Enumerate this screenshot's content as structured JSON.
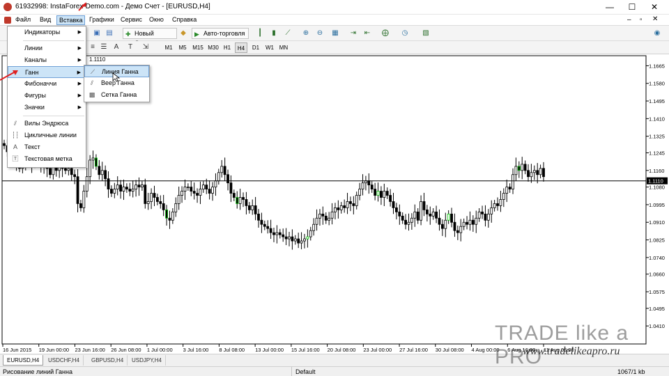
{
  "window": {
    "title": "61932998: InstaForex-Demo.com - Демо Счет - [EURUSD,H4]",
    "controls": [
      "—",
      "☐",
      "✕"
    ]
  },
  "menubar": {
    "items": [
      "Файл",
      "Вид",
      "Вставка",
      "Графики",
      "Сервис",
      "Окно",
      "Справка"
    ],
    "active_index": 2
  },
  "toolbar1": {
    "new_order_label": "Новый Ордер",
    "autotrade_label": "Авто-торговля"
  },
  "toolbar2": {
    "timeframes": [
      "M1",
      "M5",
      "M15",
      "M30",
      "H1",
      "H4",
      "D1",
      "W1",
      "MN"
    ],
    "selected_timeframe": "H4"
  },
  "insert_menu": {
    "items": [
      {
        "label": "Индикаторы",
        "submenu": true,
        "icon": ""
      },
      {
        "label": "Линии",
        "submenu": true,
        "icon": ""
      },
      {
        "label": "Каналы",
        "submenu": true,
        "icon": ""
      },
      {
        "label": "Ганн",
        "submenu": true,
        "icon": "",
        "active": true
      },
      {
        "label": "Фибоначчи",
        "submenu": true,
        "icon": ""
      },
      {
        "label": "Фигуры",
        "submenu": true,
        "icon": ""
      },
      {
        "label": "Значки",
        "submenu": true,
        "icon": ""
      },
      {
        "label": "Вилы Эндрюса",
        "submenu": false,
        "icon": "pitchfork-icon"
      },
      {
        "label": "Цикличные линии",
        "submenu": false,
        "icon": "cycle-lines-icon"
      },
      {
        "label": "Текст",
        "submenu": false,
        "icon": "text-icon"
      },
      {
        "label": "Текстовая метка",
        "submenu": false,
        "icon": "text-label-icon"
      }
    ]
  },
  "gann_submenu": {
    "items": [
      {
        "label": "Линия Ганна",
        "icon": "gann-line-icon",
        "active": true
      },
      {
        "label": "Веер Ганна",
        "icon": "gann-fan-icon"
      },
      {
        "label": "Сетка Ганна",
        "icon": "gann-grid-icon"
      }
    ]
  },
  "chart": {
    "symbol_info": "1.1110",
    "current_price": "1.1110",
    "price_labels": [
      "1.1665",
      "1.1580",
      "1.1495",
      "1.1410",
      "1.1325",
      "1.1245",
      "1.1160",
      "1.1080",
      "1.0995",
      "1.0910",
      "1.0825",
      "1.0740",
      "1.0660",
      "1.0575",
      "1.0495",
      "1.0410"
    ],
    "date_labels": [
      "16 Jun 2015",
      "19 Jun 00:00",
      "23 Jun 16:00",
      "26 Jun 08:00",
      "1 Jul 00:00",
      "3 Jul 16:00",
      "8 Jul 08:00",
      "13 Jul 00:00",
      "15 Jul 16:00",
      "20 Jul 08:00",
      "23 Jul 00:00",
      "27 Jul 16:00",
      "30 Jul 08:00",
      "4 Aug 00:00",
      "6 Aug 16:00",
      "11 Aug 08:00"
    ],
    "colors": {
      "up": "#00c000",
      "down": "#000000",
      "price_line": "#000000"
    }
  },
  "chart_data": {
    "type": "candlestick",
    "symbol": "EURUSD",
    "timeframe": "H4",
    "ylim": [
      1.035,
      1.17
    ],
    "current_price": 1.111,
    "closes": [
      1.128,
      1.125,
      1.124,
      1.121,
      1.12,
      1.117,
      1.119,
      1.121,
      1.122,
      1.119,
      1.12,
      1.121,
      1.118,
      1.119,
      1.117,
      1.114,
      1.118,
      1.116,
      1.118,
      1.117,
      1.116,
      1.117,
      1.114,
      1.113,
      1.1,
      1.098,
      1.106,
      1.113,
      1.121,
      1.122,
      1.118,
      1.114,
      1.116,
      1.112,
      1.107,
      1.105,
      1.107,
      1.109,
      1.106,
      1.108,
      1.107,
      1.106,
      1.107,
      1.109,
      1.108,
      1.109,
      1.1,
      1.101,
      1.105,
      1.103,
      1.101,
      1.1,
      1.097,
      1.093,
      1.092,
      1.096,
      1.1,
      1.104,
      1.106,
      1.108,
      1.108,
      1.106,
      1.105,
      1.104,
      1.107,
      1.109,
      1.107,
      1.105,
      1.108,
      1.111,
      1.115,
      1.118,
      1.114,
      1.11,
      1.105,
      1.103,
      1.1,
      1.103,
      1.102,
      1.099,
      1.097,
      1.099,
      1.095,
      1.092,
      1.09,
      1.089,
      1.088,
      1.086,
      1.085,
      1.086,
      1.085,
      1.084,
      1.083,
      1.084,
      1.082,
      1.083,
      1.081,
      1.082,
      1.083,
      1.084,
      1.087,
      1.09,
      1.093,
      1.095,
      1.094,
      1.092,
      1.093,
      1.096,
      1.098,
      1.097,
      1.099,
      1.098,
      1.101,
      1.1,
      1.099,
      1.104,
      1.107,
      1.11,
      1.111,
      1.109,
      1.107,
      1.104,
      1.106,
      1.103,
      1.106,
      1.104,
      1.101,
      1.098,
      1.096,
      1.094,
      1.092,
      1.09,
      1.091,
      1.093,
      1.096,
      1.092,
      1.101,
      1.097,
      1.095,
      1.094,
      1.096,
      1.093,
      1.09,
      1.088,
      1.092,
      1.095,
      1.091,
      1.087,
      1.086,
      1.089,
      1.091,
      1.09,
      1.092,
      1.09,
      1.093,
      1.096,
      1.095,
      1.092,
      1.095,
      1.098,
      1.1,
      1.099,
      1.102,
      1.105,
      1.108,
      1.107,
      1.114,
      1.118,
      1.116,
      1.119,
      1.116,
      1.113,
      1.115,
      1.116,
      1.114,
      1.117,
      1.113
    ]
  },
  "tabs": {
    "items": [
      "EURUSD,H4",
      "USDCHF,H4",
      "GBPUSD,H4",
      "USDJPY,H4"
    ],
    "active_index": 0
  },
  "statusbar": {
    "hint": "Рисование линий Ганна",
    "profile": "Default",
    "traffic": "1067/1 kb"
  },
  "watermark": {
    "brand": "TRADE like a PRO",
    "url": "www.tradelikeapro.ru"
  }
}
